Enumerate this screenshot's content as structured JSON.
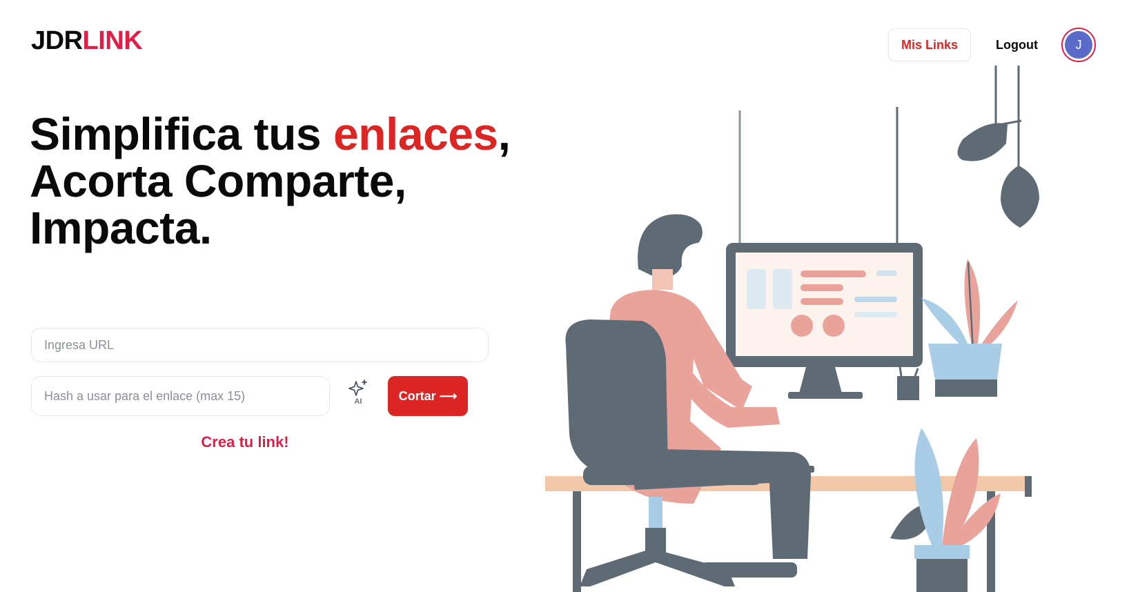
{
  "brand": {
    "part1": "JDR",
    "part2": "LINK"
  },
  "nav": {
    "my_links": "Mis Links",
    "logout": "Logout",
    "avatar_initial": "J"
  },
  "hero": {
    "line1_start": "Simplifica tus ",
    "line1_accent": "enlaces",
    "line1_end": ",",
    "line2": "Acorta Comparte,",
    "line3": "Impacta."
  },
  "form": {
    "url_placeholder": "Ingresa URL",
    "hash_placeholder": "Hash a usar para el enlace (max 15)",
    "ai_label": "AI",
    "submit_label": "Cortar ⟶",
    "cta": "Crea tu link!"
  },
  "colors": {
    "accent": "#dc2626",
    "brand_accent": "#e11d48",
    "avatar_bg": "#5b6bc9",
    "illustration_dark": "#5e6b75",
    "illustration_pink": "#e9a39a",
    "illustration_blue": "#a9cde6"
  }
}
